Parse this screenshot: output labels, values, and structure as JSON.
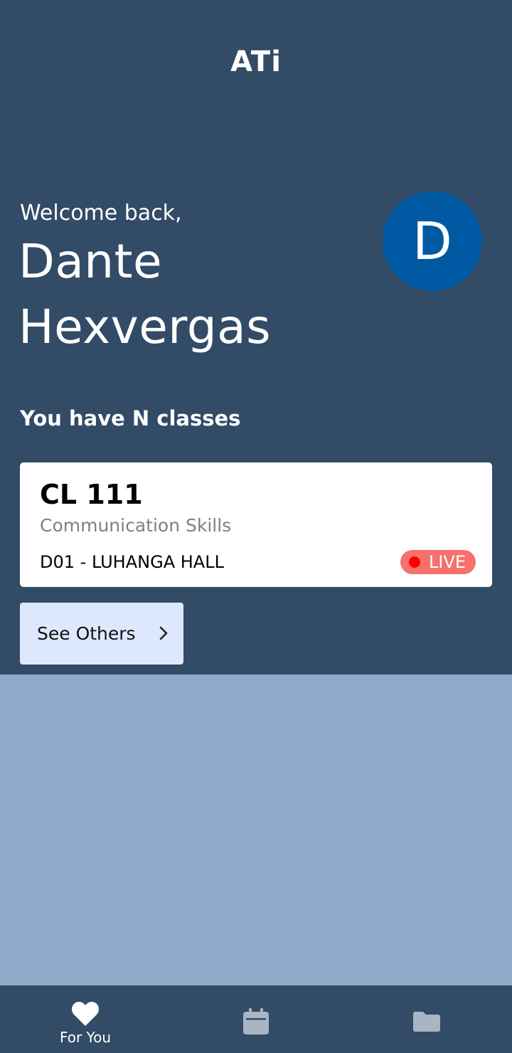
{
  "app": {
    "logo_text": "ATi"
  },
  "greeting": {
    "welcome_text": "Welcome back,",
    "user_name": "Dante Hexvergas",
    "avatar_initial": "D",
    "avatar_color": "#005aa3"
  },
  "classes": {
    "summary": "You have N classes",
    "current": {
      "code": "CL 111",
      "name": "Communication Skills",
      "venue": "D01 - LUHANGA HALL",
      "status": "LIVE",
      "status_color": "#f7706c"
    },
    "see_others_label": "See Others"
  },
  "bottom_nav": {
    "items": [
      {
        "label": "For You",
        "icon": "heart-icon",
        "active": true
      },
      {
        "label": "",
        "icon": "calendar-icon",
        "active": false
      },
      {
        "label": "",
        "icon": "folder-icon",
        "active": false
      }
    ]
  },
  "colors": {
    "header_bg": "#324b66",
    "page_bg": "#8eacca",
    "see_others_bg": "#dde8fd",
    "inactive_icon": "#a9b5c3"
  }
}
